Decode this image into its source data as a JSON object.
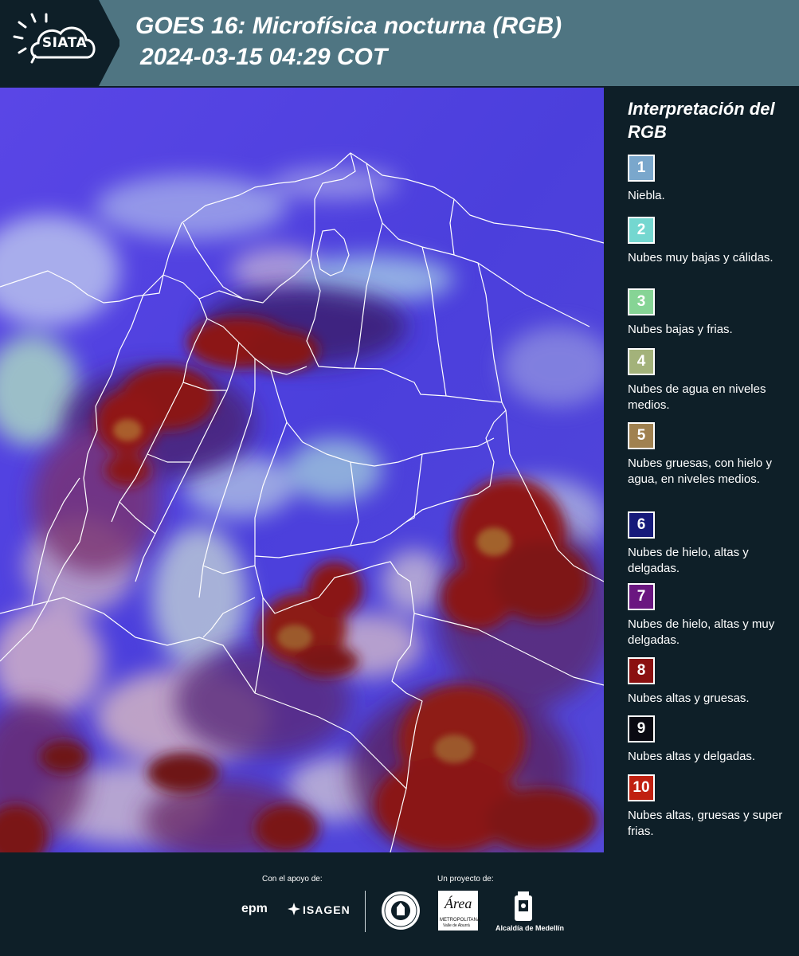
{
  "header": {
    "logo_text": "SIATA",
    "title_line1": "GOES 16: Microfísica nocturna (RGB)",
    "title_line2": "2024-03-15 04:29 COT"
  },
  "legend": {
    "title": "Interpretación del RGB",
    "items": [
      {
        "number": "1",
        "label": "Niebla.",
        "color": "#7aa7cc"
      },
      {
        "number": "2",
        "label": "Nubes muy bajas y cálidas.",
        "color": "#74d7d0"
      },
      {
        "number": "3",
        "label": "Nubes bajas y frias.",
        "color": "#86d495"
      },
      {
        "number": "4",
        "label": "Nubes de agua en niveles medios.",
        "color": "#a3b27a"
      },
      {
        "number": "5",
        "label": "Nubes gruesas, con hielo y agua, en niveles medios.",
        "color": "#a08150"
      },
      {
        "number": "6",
        "label": "Nubes de hielo, altas y delgadas.",
        "color": "#161a7a"
      },
      {
        "number": "7",
        "label": "Nubes de hielo, altas y muy delgadas.",
        "color": "#6a1680"
      },
      {
        "number": "8",
        "label": "Nubes altas y gruesas.",
        "color": "#8a1010"
      },
      {
        "number": "9",
        "label": "Nubes altas y delgadas.",
        "color": "#0a0a12"
      },
      {
        "number": "10",
        "label": "Nubes altas, gruesas y super frias.",
        "color": "#c02010"
      }
    ]
  },
  "map": {
    "background_color": "#4a3fe0",
    "thick_cloud_color": "#8a1414",
    "thin_cloud_color": "#7a2a8a",
    "low_cloud_color": "#b0b8e0",
    "border_color": "#ffffff"
  },
  "footer": {
    "support_label": "Con el apoyo de:",
    "project_label": "Un proyecto de:",
    "epm": "epm",
    "isagen": "ISAGEN",
    "area_title": "Área",
    "area_sub1": "METROPOLITANA",
    "area_sub2": "Valle de Aburrá",
    "alcaldia": "Alcaldía de Medellín"
  }
}
